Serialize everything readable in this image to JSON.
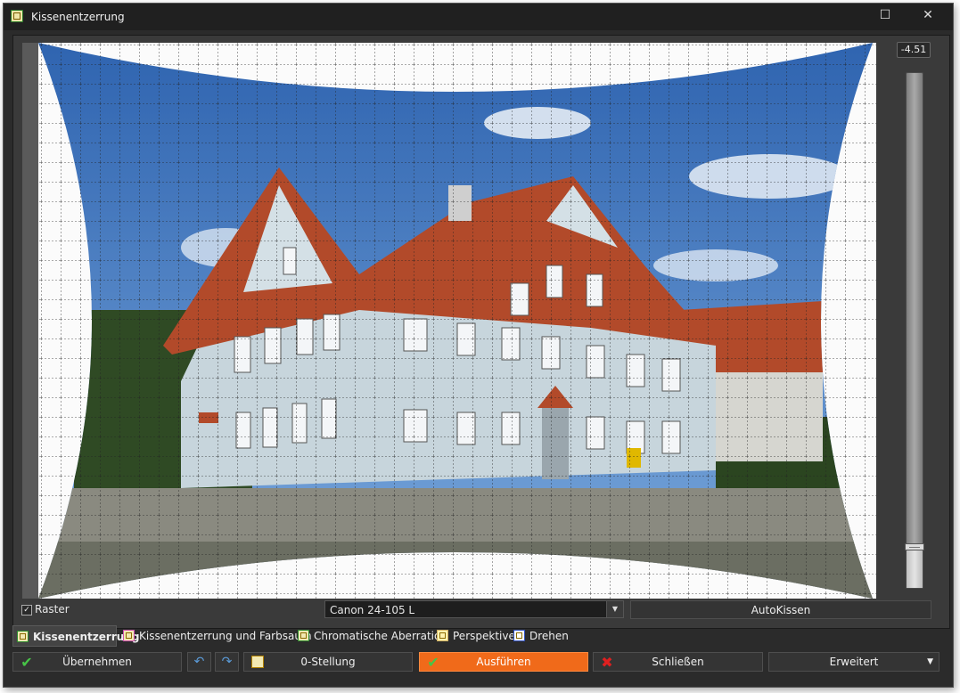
{
  "window": {
    "title": "Kissenentzerrung",
    "maximize_glyph": "☐",
    "close_glyph": "✕"
  },
  "slider": {
    "value_text": "-4.51",
    "level_fraction": 0.08
  },
  "options": {
    "raster_label": "Raster",
    "raster_checked": true,
    "lens_selected": "Canon 24-105 L",
    "autokissen_label": "AutoKissen"
  },
  "tabs": [
    {
      "label": "Kissenentzerrung",
      "icon": "pincushion-icon",
      "active": true
    },
    {
      "label": "Kissenentzerrung und Farbsaum",
      "icon": "pincushion-fringe-icon",
      "active": false
    },
    {
      "label": "Chromatische Aberration",
      "icon": "chromatic-icon",
      "active": false
    },
    {
      "label": "Perspektive",
      "icon": "perspective-icon",
      "active": false
    },
    {
      "label": "Drehen",
      "icon": "rotate-icon",
      "active": false
    }
  ],
  "buttons": {
    "apply_label": "Übernehmen",
    "undo_icon": "undo-icon",
    "redo_icon": "redo-icon",
    "zero_label": "0-Stellung",
    "execute_label": "Ausführen",
    "close_label": "Schließen",
    "extended_label": "Erweitert"
  },
  "colors": {
    "accent": "#f06a1a",
    "bg": "#2b2b2b",
    "sky": "#3f78c0",
    "roof": "#b24a2a",
    "wall": "#c7d5dc"
  }
}
